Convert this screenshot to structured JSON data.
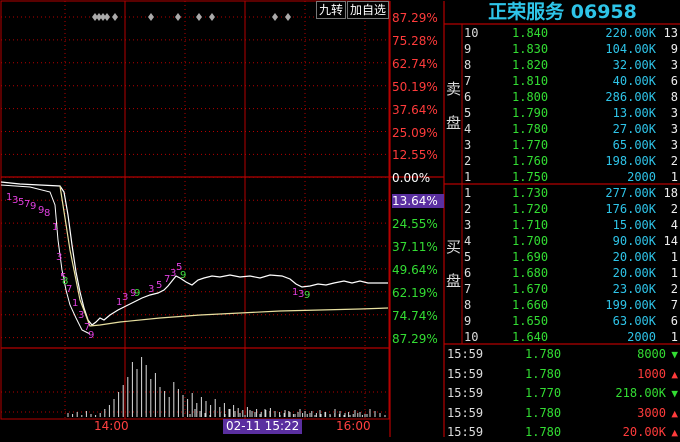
{
  "stock_title": "正荣服务 06958",
  "toolbar": {
    "jiuzhuan": "九转",
    "add_watch": "加自选"
  },
  "y_axis_labels": [
    {
      "text": "87.29%",
      "kind": "pos"
    },
    {
      "text": "75.28%",
      "kind": "pos"
    },
    {
      "text": "62.74%",
      "kind": "pos"
    },
    {
      "text": "50.19%",
      "kind": "pos"
    },
    {
      "text": "37.64%",
      "kind": "pos"
    },
    {
      "text": "25.09%",
      "kind": "pos"
    },
    {
      "text": "12.55%",
      "kind": "pos"
    },
    {
      "text": "0.00%",
      "kind": "zero"
    },
    {
      "text": "13.64%",
      "kind": "hl"
    },
    {
      "text": "24.55%",
      "kind": "neg"
    },
    {
      "text": "37.11%",
      "kind": "neg"
    },
    {
      "text": "49.64%",
      "kind": "neg"
    },
    {
      "text": "62.19%",
      "kind": "neg"
    },
    {
      "text": "74.74%",
      "kind": "neg"
    },
    {
      "text": "87.29%",
      "kind": "neg"
    }
  ],
  "x_axis": {
    "left": "14:00",
    "right": "16:00",
    "cursor": "02-11 15:22"
  },
  "order_book": {
    "sell_label": [
      "卖",
      "盘"
    ],
    "buy_label": [
      "买",
      "盘"
    ],
    "sell": [
      {
        "level": "10",
        "price": "1.840",
        "volume": "220.00K",
        "count": "13"
      },
      {
        "level": "9",
        "price": "1.830",
        "volume": "104.00K",
        "count": "9"
      },
      {
        "level": "8",
        "price": "1.820",
        "volume": "32.00K",
        "count": "3"
      },
      {
        "level": "7",
        "price": "1.810",
        "volume": "40.00K",
        "count": "6"
      },
      {
        "level": "6",
        "price": "1.800",
        "volume": "286.00K",
        "count": "8"
      },
      {
        "level": "5",
        "price": "1.790",
        "volume": "13.00K",
        "count": "3"
      },
      {
        "level": "4",
        "price": "1.780",
        "volume": "27.00K",
        "count": "3"
      },
      {
        "level": "3",
        "price": "1.770",
        "volume": "65.00K",
        "count": "3"
      },
      {
        "level": "2",
        "price": "1.760",
        "volume": "198.00K",
        "count": "2"
      },
      {
        "level": "1",
        "price": "1.750",
        "volume": "2000",
        "count": "1"
      }
    ],
    "buy": [
      {
        "level": "1",
        "price": "1.730",
        "volume": "277.00K",
        "count": "18"
      },
      {
        "level": "2",
        "price": "1.720",
        "volume": "176.00K",
        "count": "2"
      },
      {
        "level": "3",
        "price": "1.710",
        "volume": "15.00K",
        "count": "4"
      },
      {
        "level": "4",
        "price": "1.700",
        "volume": "90.00K",
        "count": "14"
      },
      {
        "level": "5",
        "price": "1.690",
        "volume": "20.00K",
        "count": "1"
      },
      {
        "level": "6",
        "price": "1.680",
        "volume": "20.00K",
        "count": "1"
      },
      {
        "level": "7",
        "price": "1.670",
        "volume": "23.00K",
        "count": "2"
      },
      {
        "level": "8",
        "price": "1.660",
        "volume": "199.00K",
        "count": "7"
      },
      {
        "level": "9",
        "price": "1.650",
        "volume": "63.00K",
        "count": "6"
      },
      {
        "level": "10",
        "price": "1.640",
        "volume": "2000",
        "count": "1"
      }
    ]
  },
  "trades": [
    {
      "time": "15:59",
      "price": "1.780",
      "volume": "8000",
      "dir": "dn",
      "arrow": "▼"
    },
    {
      "time": "15:59",
      "price": "1.780",
      "volume": "1000",
      "dir": "up",
      "arrow": "▲"
    },
    {
      "time": "15:59",
      "price": "1.770",
      "volume": "218.00K",
      "dir": "dn",
      "arrow": "▼"
    },
    {
      "time": "15:59",
      "price": "1.780",
      "volume": "3000",
      "dir": "up",
      "arrow": "▲"
    },
    {
      "time": "15:59",
      "price": "1.780",
      "volume": "20.00K",
      "dir": "up",
      "arrow": "▲"
    }
  ],
  "colors": {
    "grid": "#b40000",
    "price_line": "#ffffff",
    "avg_line": "#e8e0a0",
    "accent": "#2ec4e8",
    "up": "#ff3b3b",
    "down": "#33dd33"
  }
}
